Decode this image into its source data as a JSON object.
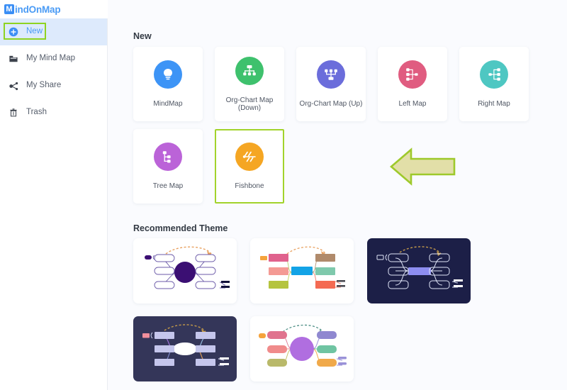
{
  "app": {
    "logo_mark": "M",
    "logo_text": "indOnMap",
    "accent": "#4a9bf5",
    "highlight_green": "#8ed321",
    "arrow_fill": "#e2dfa8",
    "arrow_stroke": "#9ec92b"
  },
  "sidebar": {
    "items": [
      {
        "label": "New",
        "icon": "plus-circle-icon",
        "active": true
      },
      {
        "label": "My Mind Map",
        "icon": "folder-icon",
        "active": false
      },
      {
        "label": "My Share",
        "icon": "share-nodes-icon",
        "active": false
      },
      {
        "label": "Trash",
        "icon": "trash-icon",
        "active": false
      }
    ]
  },
  "main": {
    "new_section": {
      "title": "New",
      "cards": [
        {
          "label": "MindMap",
          "icon": "lightbulb-icon",
          "color": "#3d94f6",
          "selected": false
        },
        {
          "label": "Org-Chart Map (Down)",
          "icon": "org-chart-down-icon",
          "color": "#3ec16d",
          "selected": false
        },
        {
          "label": "Org-Chart Map (Up)",
          "icon": "org-chart-up-icon",
          "color": "#6b6ddb",
          "selected": false
        },
        {
          "label": "Left Map",
          "icon": "left-map-icon",
          "color": "#e05c80",
          "selected": false
        },
        {
          "label": "Right Map",
          "icon": "right-map-icon",
          "color": "#4ec7c2",
          "selected": false
        },
        {
          "label": "Tree Map",
          "icon": "tree-map-icon",
          "color": "#bb63d8",
          "selected": false
        },
        {
          "label": "Fishbone",
          "icon": "fishbone-icon",
          "color": "#f5a623",
          "selected": true
        }
      ]
    },
    "theme_section": {
      "title": "Recommended Theme",
      "themes": [
        {
          "name": "theme-light-purple",
          "style": "light"
        },
        {
          "name": "theme-light-colorful",
          "style": "light"
        },
        {
          "name": "theme-dark-blue",
          "style": "dark"
        },
        {
          "name": "theme-dark-violet",
          "style": "dark2"
        },
        {
          "name": "theme-light-violet",
          "style": "light"
        }
      ]
    },
    "pointer": {
      "name": "callout-arrow",
      "target": "Fishbone"
    }
  }
}
